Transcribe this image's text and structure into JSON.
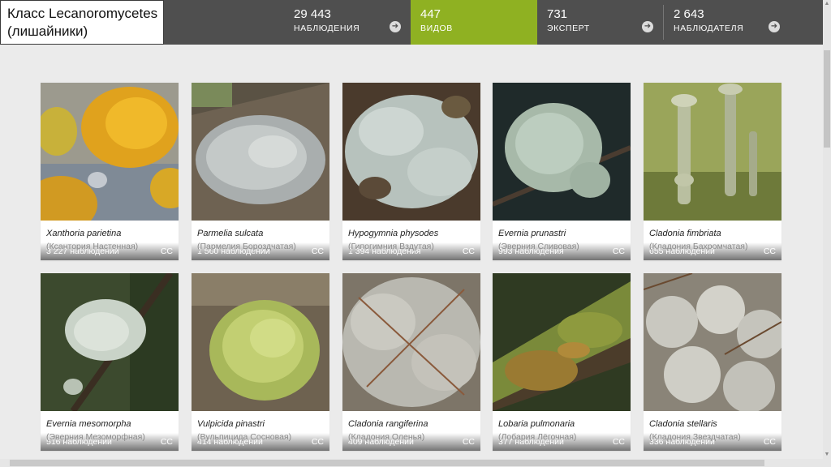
{
  "header": {
    "title_line1": "Класс Lecanoromycetes",
    "title_line2": "(лишайники)",
    "stats": [
      {
        "value": "29 443",
        "label": "НАБЛЮДЕНИЯ",
        "arrow_icon": "arrow-right-circle-icon"
      },
      {
        "value": "447",
        "label": "ВИДОВ",
        "active": true
      },
      {
        "value": "731",
        "label": "ЭКСПЕРТ",
        "arrow_icon": "arrow-right-circle-icon"
      },
      {
        "value": "2 643",
        "label": "НАБЛЮДАТЕЛЯ",
        "arrow_icon": "arrow-right-circle-icon"
      }
    ],
    "active_color": "#8fb122",
    "bar_color": "#4f4f4f"
  },
  "species": [
    {
      "latin": "Xanthoria parietina",
      "russian": "(Ксантория Настенная)",
      "count": "3 227 наблюдений",
      "license": "CC"
    },
    {
      "latin": "Parmelia sulcata",
      "russian": "(Пармелия Бороздчатая)",
      "count": "1 560 наблюдений",
      "license": "CC"
    },
    {
      "latin": "Hypogymnia physodes",
      "russian": "(Гипогимния Вздутая)",
      "count": "1 394 наблюдения",
      "license": "CC"
    },
    {
      "latin": "Evernia prunastri",
      "russian": "(Эверния Сливовая)",
      "count": "993 наблюдения",
      "license": "CC"
    },
    {
      "latin": "Cladonia fimbriata",
      "russian": "(Кладония Бахромчатая)",
      "count": "655 наблюдений",
      "license": "CC"
    },
    {
      "latin": "Evernia mesomorpha",
      "russian": "(Эверния Мезоморфная)",
      "count": "516 наблюдений",
      "license": "CC"
    },
    {
      "latin": "Vulpicida pinastri",
      "russian": "(Вульпицида Сосновая)",
      "count": "414 наблюдений",
      "license": "CC"
    },
    {
      "latin": "Cladonia rangiferina",
      "russian": "(Кладония Оленья)",
      "count": "409 наблюдений",
      "license": "CC"
    },
    {
      "latin": "Lobaria pulmonaria",
      "russian": "(Лобария Лёгочная)",
      "count": "377 наблюдений",
      "license": "CC"
    },
    {
      "latin": "Cladonia stellaris",
      "russian": "(Кладония Звездчатая)",
      "count": "336 наблюдений",
      "license": "CC"
    }
  ]
}
